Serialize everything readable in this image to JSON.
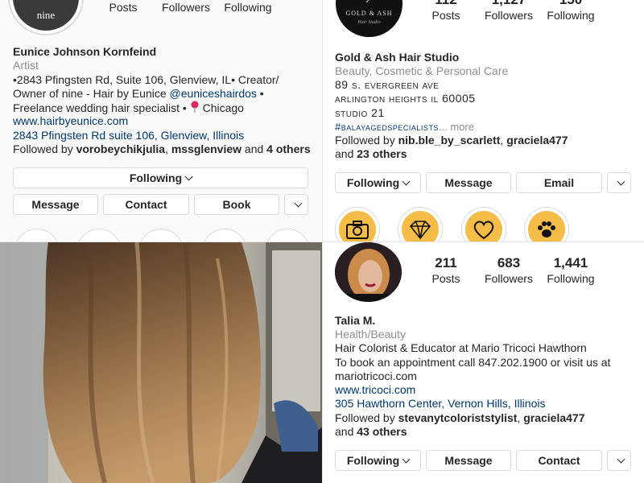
{
  "profile1": {
    "avatar_text": "nine",
    "stats": [
      {
        "label": "Posts"
      },
      {
        "label": "Followers"
      },
      {
        "label": "Following"
      }
    ],
    "name": "Eunice Johnson Kornfeind",
    "category": "Artist",
    "bio_line1": "•2843 Pfingsten Rd, Suite 106, Glenview, IL• Creator/",
    "bio_line2a": "Owner of nine - Hair by Eunice ",
    "bio_mention": "@euniceshairdos",
    "bio_line2b": " •",
    "bio_line3a": "Freelance wedding hair specialist  •",
    "bio_line3b": "Chicago",
    "website": "www.hairbyeunice.com",
    "address": "2843 Pfingsten Rd suite 106, Glenview, Illinois",
    "followed_prefix": "Followed by ",
    "followed_user1": "vorobeychikjulia",
    "followed_sep": ", ",
    "followed_user2": "mssglenview",
    "followed_and": " and ",
    "followed_others": "4 others",
    "buttons": {
      "following": "Following",
      "message": "Message",
      "contact": "Contact",
      "book": "Book"
    }
  },
  "profile2": {
    "avatar_text": "GOLD & ASH",
    "avatar_sub": "Hair Studio",
    "stats": [
      {
        "value": "112",
        "label": "Posts"
      },
      {
        "value": "1,127",
        "label": "Followers"
      },
      {
        "value": "150",
        "label": "Following"
      }
    ],
    "name": "Gold & Ash Hair Studio",
    "category": "Beauty, Cosmetic & Personal Care",
    "addr1": "89 s. evergreen ave",
    "addr2": "arlington heights il 60005",
    "addr3": "studio 21",
    "hashtag": "#balayagedspecialists",
    "more": "... more",
    "followed_prefix": "Followed by ",
    "followed_user1": "nib.ble_by_scarlett",
    "followed_sep": ", ",
    "followed_user2": "graciela477",
    "followed_and": "and ",
    "followed_others": "23 others",
    "buttons": {
      "following": "Following",
      "message": "Message",
      "email": "Email"
    },
    "highlights": [
      "camera-icon",
      "diamond-icon",
      "heart-icon",
      "paw-icon"
    ]
  },
  "profile3": {
    "stats": [
      {
        "value": "211",
        "label": "Posts"
      },
      {
        "value": "683",
        "label": "Followers"
      },
      {
        "value": "1,441",
        "label": "Following"
      }
    ],
    "name": "Talia M.",
    "category": "Health/Beauty",
    "bio_line1": "Hair Colorist & Educator at Mario Tricoci Hawthorn",
    "bio_line2": "To book an appointment call 847.202.1900 or visit us at",
    "bio_line3": "mariotricoci.com",
    "website": "www.tricoci.com",
    "address": "305 Hawthorn Center, Vernon Hills, Illinois",
    "followed_prefix": "Followed by ",
    "followed_user1": "stevanytcoloriststylist",
    "followed_sep": ", ",
    "followed_user2": "graciela477",
    "followed_and": "and ",
    "followed_others": "43 others",
    "buttons": {
      "following": "Following",
      "message": "Message",
      "contact": "Contact"
    }
  },
  "colors": {
    "link": "#00376b",
    "muted": "#8e8e8e",
    "highlight": "#f5bd47",
    "border": "#dbdbdb"
  }
}
